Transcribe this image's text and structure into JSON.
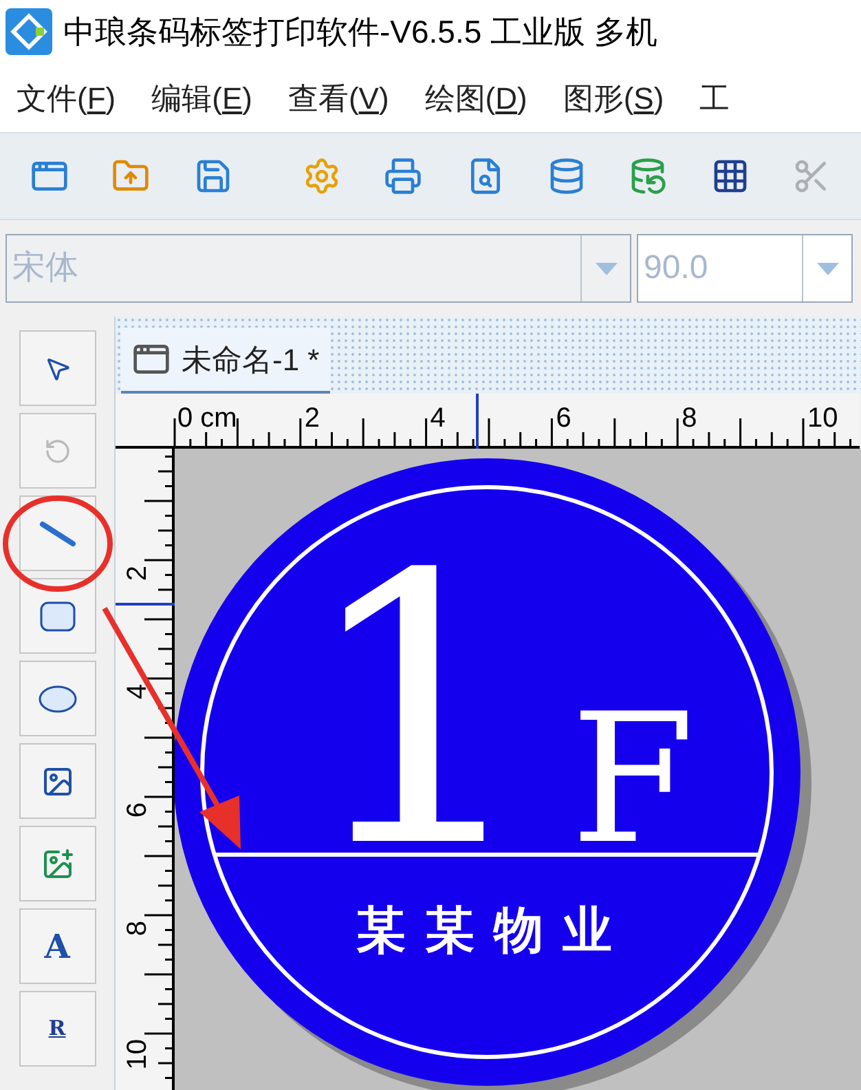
{
  "window": {
    "title": "中琅条码标签打印软件-V6.5.5 工业版 多机"
  },
  "menu": [
    {
      "before": "文件(",
      "key": "F",
      "after": ")"
    },
    {
      "before": "编辑(",
      "key": "E",
      "after": ")"
    },
    {
      "before": "查看(",
      "key": "V",
      "after": ")"
    },
    {
      "before": "绘图(",
      "key": "D",
      "after": ")"
    },
    {
      "before": "图形(",
      "key": "S",
      "after": ")"
    },
    {
      "before": "工"
    }
  ],
  "toolbar": [
    {
      "kind": "window",
      "disabled": false
    },
    {
      "kind": "open",
      "disabled": false
    },
    {
      "kind": "save",
      "disabled": false
    },
    {
      "kind": "gear",
      "disabled": false
    },
    {
      "kind": "print",
      "disabled": false
    },
    {
      "kind": "preview",
      "disabled": false
    },
    {
      "kind": "database",
      "disabled": false
    },
    {
      "kind": "database-check",
      "disabled": false
    },
    {
      "kind": "grid",
      "disabled": false
    },
    {
      "kind": "scissors",
      "disabled": true
    }
  ],
  "font": {
    "family": "宋体",
    "size": "90.0",
    "disabled": true
  },
  "tools": [
    {
      "kind": "pointer",
      "disabled": false
    },
    {
      "kind": "rotate",
      "disabled": true
    },
    {
      "kind": "line",
      "disabled": false
    },
    {
      "kind": "rect",
      "disabled": false
    },
    {
      "kind": "ellipse",
      "disabled": false
    },
    {
      "kind": "image",
      "disabled": false
    },
    {
      "kind": "picture",
      "disabled": false
    },
    {
      "kind": "text",
      "glyph": "A",
      "disabled": false
    },
    {
      "kind": "rich-text",
      "glyph": "R",
      "disabled": false
    }
  ],
  "document_tab": {
    "title": "未命名-1 *",
    "selected": true
  },
  "ruler": {
    "unit_label": "0 cm",
    "h_labels": [
      "2",
      "4",
      "6",
      "8",
      "10"
    ],
    "v_labels": [
      "2",
      "4",
      "6",
      "8",
      "10"
    ]
  },
  "label": {
    "number": "1",
    "letter": "F",
    "name": "某某物业"
  }
}
